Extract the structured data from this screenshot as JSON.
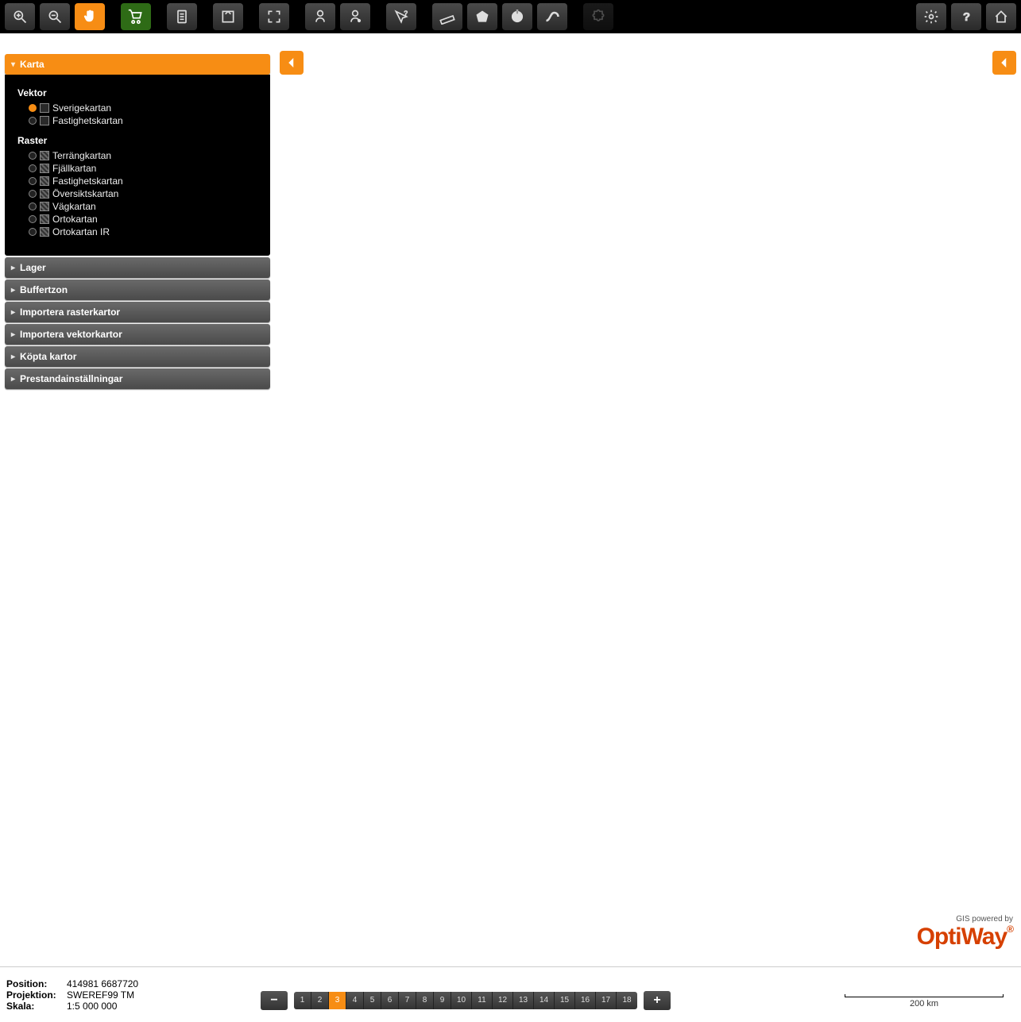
{
  "toolbar": {
    "buttons": [
      {
        "name": "zoom-in-icon",
        "active": false
      },
      {
        "name": "zoom-out-icon",
        "active": false
      },
      {
        "name": "pan-icon",
        "active": true,
        "color": "orange"
      },
      {
        "name": "cart-icon",
        "active": false,
        "color": "green"
      },
      {
        "name": "doc-icon"
      },
      {
        "name": "export-icon"
      },
      {
        "name": "fullextent-icon"
      },
      {
        "name": "identify-feature-icon"
      },
      {
        "name": "identify-point-icon"
      },
      {
        "name": "select-question-icon"
      },
      {
        "name": "ruler-icon"
      },
      {
        "name": "shape-icon"
      },
      {
        "name": "circle-icon"
      },
      {
        "name": "path-icon"
      },
      {
        "name": "puzzle-icon"
      },
      {
        "name": "gear-icon"
      },
      {
        "name": "help-icon"
      },
      {
        "name": "home-icon"
      }
    ]
  },
  "sidebar": {
    "sections": [
      {
        "title": "Karta",
        "open": true
      },
      {
        "title": "Lager"
      },
      {
        "title": "Buffertzon"
      },
      {
        "title": "Importera rasterkartor"
      },
      {
        "title": "Importera vektorkartor"
      },
      {
        "title": "Köpta kartor"
      },
      {
        "title": "Prestandainställningar"
      }
    ],
    "karta": {
      "vektor_title": "Vektor",
      "raster_title": "Raster",
      "vektor": [
        {
          "label": "Sverigekartan",
          "on": true
        },
        {
          "label": "Fastighetskartan",
          "on": false
        }
      ],
      "raster": [
        {
          "label": "Terrängkartan",
          "on": false
        },
        {
          "label": "Fjällkartan",
          "on": false
        },
        {
          "label": "Fastighetskartan",
          "on": false
        },
        {
          "label": "Översiktskartan",
          "on": false
        },
        {
          "label": "Vägkartan",
          "on": false
        },
        {
          "label": "Ortokartan",
          "on": false
        },
        {
          "label": "Ortokartan IR",
          "on": false
        }
      ]
    }
  },
  "credits": {
    "small": "GIS powered by",
    "brand": "OptiWay"
  },
  "status": {
    "position_label": "Position:",
    "position_value": "414981 6687720",
    "projection_label": "Projektion:",
    "projection_value": "SWEREF99 TM",
    "scale_label": "Skala:",
    "scale_value": "1:5 000 000"
  },
  "zoom": {
    "levels": [
      "1",
      "2",
      "3",
      "4",
      "5",
      "6",
      "7",
      "8",
      "9",
      "10",
      "11",
      "12",
      "13",
      "14",
      "15",
      "16",
      "17",
      "18"
    ],
    "selected_index": 2
  },
  "scalebar": {
    "label": "200 km"
  }
}
